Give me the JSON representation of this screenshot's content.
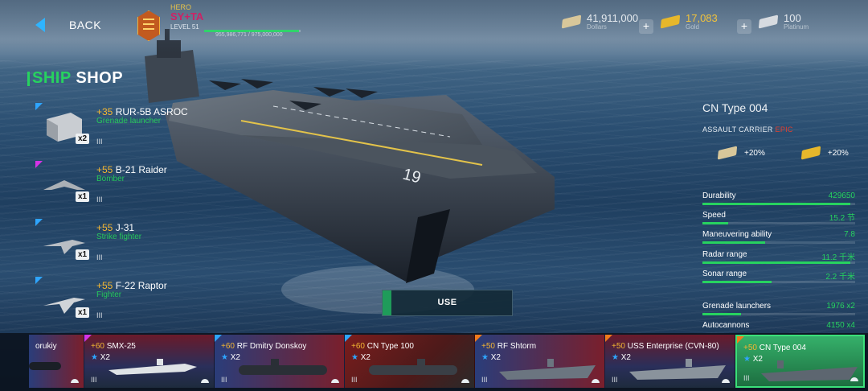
{
  "header": {
    "back_label": "BACK",
    "player": {
      "badge": "HERO",
      "name": "SY+TA",
      "level": "LEVEL 51",
      "xp_text": "955,986,771 / 975,000,000",
      "xp_progress": 0.98
    },
    "currencies": [
      {
        "name": "dollars-icon",
        "value": "41,911,000",
        "label": "Dollars",
        "color": "#d8c79a"
      },
      {
        "name": "gold-icon",
        "value": "17,083",
        "label": "Gold",
        "color": "#e6b72b"
      },
      {
        "name": "platinum-icon",
        "value": "100",
        "label": "Platinum",
        "color": "#d7dbe0"
      }
    ],
    "plus_label": "+"
  },
  "shop": {
    "title_accent": "SHIP",
    "title_rest": "SHOP",
    "items": [
      {
        "bonus": "+35",
        "name": "RUR-5B ASROC",
        "type": "Grenade launcher",
        "count": "x2",
        "tier": "III",
        "corner": "#2ea5ff"
      },
      {
        "bonus": "+55",
        "name": "B-21 Raider",
        "type": "Bomber",
        "count": "x1",
        "tier": "III",
        "corner": "#d633e6"
      },
      {
        "bonus": "+55",
        "name": "J-31",
        "type": "Strike fighter",
        "count": "x1",
        "tier": "III",
        "corner": "#2ea5ff"
      },
      {
        "bonus": "+55",
        "name": "F-22 Raptor",
        "type": "Fighter",
        "count": "x1",
        "tier": "III",
        "corner": "#2ea5ff"
      }
    ]
  },
  "ship": {
    "name": "CN Type 004",
    "class": "ASSAULT CARRIER",
    "rarity": "EPIC",
    "hull_number": "19",
    "bonuses": [
      {
        "icon": "dollars-icon",
        "value": "+20%"
      },
      {
        "icon": "gold-icon",
        "value": "+20%"
      }
    ],
    "stats": [
      {
        "label": "Durability",
        "value": "429650",
        "fill": 0.97
      },
      {
        "label": "Speed",
        "value": "15.2 节",
        "fill": 0.17
      },
      {
        "label": "Maneuvering ability",
        "value": "7.8",
        "fill": 0.41
      },
      {
        "label": "Radar range",
        "value": "11.2 千米",
        "fill": 0.97
      },
      {
        "label": "Sonar range",
        "value": "2.2 千米",
        "fill": 0.45
      },
      {
        "label": "Grenade launchers",
        "value": "1976 x2",
        "fill": 0.25
      },
      {
        "label": "Autocannons",
        "value": "4150 x4",
        "fill": 0.5
      }
    ],
    "use_label": "USE"
  },
  "fleet": [
    {
      "bonus": "",
      "name": "orukiy",
      "count": "",
      "tier": "",
      "corner": "#2ea5ff",
      "flag": "flag-ru"
    },
    {
      "bonus": "+60",
      "name": "SMX-25",
      "count": "X2",
      "tier": "III",
      "corner": "#d633e6",
      "flag": "flag-us"
    },
    {
      "bonus": "+60",
      "name": "RF Dmitry Donskoy",
      "count": "X2",
      "tier": "III",
      "corner": "#2ea5ff",
      "flag": "flag-ru"
    },
    {
      "bonus": "+60",
      "name": "CN Type 100",
      "count": "X2",
      "tier": "III",
      "corner": "#2ea5ff",
      "flag": "flag-cn"
    },
    {
      "bonus": "+50",
      "name": "RF Shtorm",
      "count": "X2",
      "tier": "III",
      "corner": "#f07a1c",
      "flag": "flag-ru"
    },
    {
      "bonus": "+50",
      "name": "USS Enterprise (CVN-80)",
      "count": "X2",
      "tier": "III",
      "corner": "#f07a1c",
      "flag": "flag-us"
    },
    {
      "bonus": "+50",
      "name": "CN Type 004",
      "count": "X2",
      "tier": "III",
      "corner": "#f07a1c",
      "flag": "selected"
    }
  ]
}
